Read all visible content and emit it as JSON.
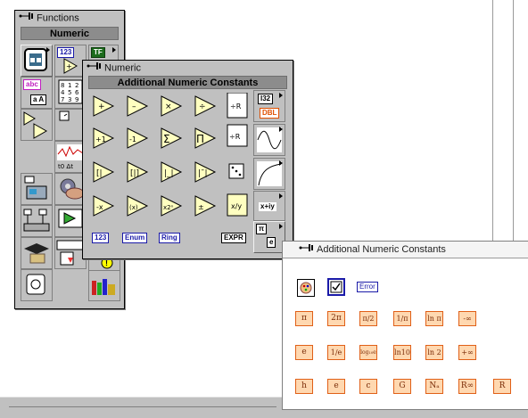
{
  "functions_palette": {
    "title": "Functions",
    "header": "Numeric",
    "row_labels": {
      "numeric_icon": "123",
      "string_icon": "abc",
      "string_sub": "a A",
      "tf_icon": "TF",
      "array_icon": "8 1 2 4 5",
      "cluster_icon": "",
      "timing_icon": "",
      "waveform_label": "t0  Δt"
    }
  },
  "numeric_palette": {
    "title": "Numeric",
    "header": "Additional Numeric Constants",
    "side_labels": {
      "i32": "I32",
      "dbl": "DBL",
      "complex": "x+iy",
      "pi": "π",
      "e": "e",
      "expr": "EXPR"
    },
    "bottom_constants": [
      "123",
      "Enum",
      "Ring"
    ]
  },
  "anc_palette": {
    "title": "Additional Numeric Constants",
    "top_row": [
      "Error"
    ],
    "row1": [
      "π",
      "2π",
      "π/2",
      "1/π",
      "ln π",
      "-∞"
    ],
    "row2": [
      "e",
      "1/e",
      "log₁₀e",
      "ln10",
      "ln 2",
      "+∞"
    ],
    "row3": [
      "h",
      "e",
      "c",
      "G",
      "Nₐ",
      "R∞",
      "R"
    ]
  },
  "colors": {
    "palette_bg": "#c0c0c0",
    "accent_orange": "#e06018",
    "constant_blue": "#1a1aa8",
    "header_gray": "#8c8c8c"
  }
}
